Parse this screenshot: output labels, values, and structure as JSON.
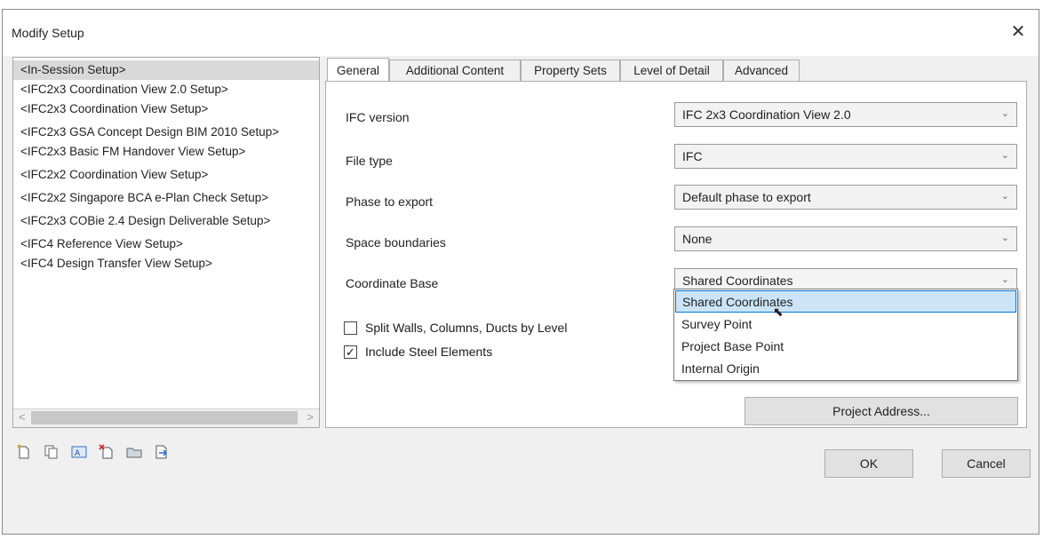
{
  "window": {
    "title": "Modify Setup"
  },
  "setups": [
    "<In-Session Setup>",
    "<IFC2x3 Coordination View 2.0 Setup>",
    "<IFC2x3 Coordination View Setup>",
    "<IFC2x3 GSA Concept Design BIM 2010 Setup>",
    "<IFC2x3 Basic FM Handover View Setup>",
    "<IFC2x2 Coordination View Setup>",
    "<IFC2x2 Singapore BCA e-Plan Check Setup>",
    "<IFC2x3 COBie 2.4 Design Deliverable Setup>",
    "<IFC4 Reference View Setup>",
    "<IFC4 Design Transfer View Setup>"
  ],
  "tabs": [
    "General",
    "Additional Content",
    "Property Sets",
    "Level of Detail",
    "Advanced"
  ],
  "general": {
    "ifc_version": {
      "label": "IFC version",
      "value": "IFC 2x3 Coordination View 2.0"
    },
    "file_type": {
      "label": "File type",
      "value": "IFC"
    },
    "phase": {
      "label": "Phase to export",
      "value": "Default phase to export"
    },
    "space_boundaries": {
      "label": "Space boundaries",
      "value": "None"
    },
    "coordinate_base": {
      "label": "Coordinate Base",
      "value": "Shared Coordinates"
    },
    "split_walls": {
      "label": "Split Walls, Columns, Ducts by Level",
      "checked": false
    },
    "include_steel": {
      "label": "Include Steel Elements",
      "checked": true,
      "mark": "✓"
    },
    "project_address_button": "Project Address..."
  },
  "coordinate_options": [
    "Shared Coordinates",
    "Survey Point",
    "Project Base Point",
    "Internal Origin"
  ],
  "buttons": {
    "ok": "OK",
    "cancel": "Cancel"
  },
  "icons": [
    "new-setup-icon",
    "duplicate-setup-icon",
    "rename-setup-icon",
    "delete-setup-icon",
    "import-setup-icon",
    "export-setup-icon"
  ],
  "colors": {
    "highlight": "#cce4f7",
    "highlight_border": "#0078d7"
  }
}
